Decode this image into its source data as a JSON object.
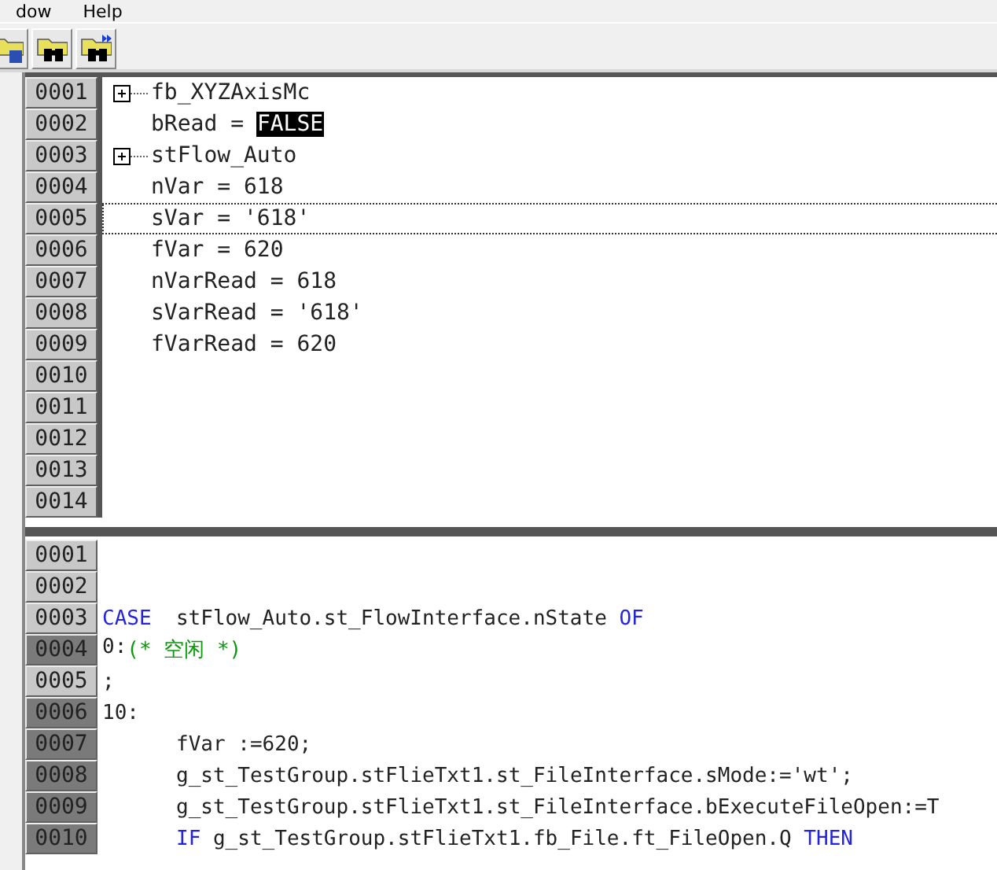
{
  "menu": [
    {
      "label": "dow"
    },
    {
      "label": "Help"
    }
  ],
  "toolbar": [
    {
      "kind": "save"
    },
    {
      "kind": "find"
    },
    {
      "kind": "find-next"
    }
  ],
  "watch": {
    "rows": [
      {
        "number": "0001",
        "expandable": true,
        "focused": false,
        "parts": [
          {
            "text": "fb_XYZAxisMc",
            "highlighted": false
          }
        ]
      },
      {
        "number": "0002",
        "expandable": false,
        "focused": false,
        "parts": [
          {
            "text": "bRead = ",
            "highlighted": false
          },
          {
            "text": "FALSE",
            "highlighted": true
          }
        ]
      },
      {
        "number": "0003",
        "expandable": true,
        "focused": false,
        "parts": [
          {
            "text": "stFlow_Auto",
            "highlighted": false
          }
        ]
      },
      {
        "number": "0004",
        "expandable": false,
        "focused": false,
        "parts": [
          {
            "text": "nVar = 618",
            "highlighted": false
          }
        ]
      },
      {
        "number": "0005",
        "expandable": false,
        "focused": true,
        "parts": [
          {
            "text": "sVar = '618'",
            "highlighted": false
          }
        ]
      },
      {
        "number": "0006",
        "expandable": false,
        "focused": false,
        "parts": [
          {
            "text": "fVar = 620",
            "highlighted": false
          }
        ]
      },
      {
        "number": "0007",
        "expandable": false,
        "focused": false,
        "parts": [
          {
            "text": "nVarRead = 618",
            "highlighted": false
          }
        ]
      },
      {
        "number": "0008",
        "expandable": false,
        "focused": false,
        "parts": [
          {
            "text": "sVarRead = '618'",
            "highlighted": false
          }
        ]
      },
      {
        "number": "0009",
        "expandable": false,
        "focused": false,
        "parts": [
          {
            "text": "fVarRead = 620",
            "highlighted": false
          }
        ]
      },
      {
        "number": "0010",
        "expandable": false,
        "focused": false
      },
      {
        "number": "0011",
        "expandable": false,
        "focused": false
      },
      {
        "number": "0012",
        "expandable": false,
        "focused": false
      },
      {
        "number": "0013",
        "expandable": false,
        "focused": false
      },
      {
        "number": "0014",
        "expandable": false,
        "focused": false
      }
    ]
  },
  "code": {
    "lines": [
      {
        "number": "0001",
        "executed": false
      },
      {
        "number": "0002",
        "executed": false
      },
      {
        "number": "0003",
        "executed": false,
        "indented": false,
        "tokens": [
          {
            "kind": "keyword",
            "text": "CASE"
          },
          {
            "kind": "plain",
            "text": "  stFlow_Auto.st_FlowInterface.nState "
          },
          {
            "kind": "keyword",
            "text": "OF"
          }
        ]
      },
      {
        "number": "0004",
        "executed": true,
        "indented": false,
        "tokens": [
          {
            "kind": "plain",
            "text": "0:"
          },
          {
            "kind": "comment",
            "text": "(* 空闲 *)"
          }
        ]
      },
      {
        "number": "0005",
        "executed": false,
        "indented": false,
        "tokens": [
          {
            "kind": "plain",
            "text": ";"
          }
        ]
      },
      {
        "number": "0006",
        "executed": true,
        "indented": false,
        "tokens": [
          {
            "kind": "plain",
            "text": "10:"
          }
        ]
      },
      {
        "number": "0007",
        "executed": true,
        "indented": true,
        "tokens": [
          {
            "kind": "plain",
            "text": "fVar :=620;"
          }
        ]
      },
      {
        "number": "0008",
        "executed": true,
        "indented": true,
        "tokens": [
          {
            "kind": "plain",
            "text": "g_st_TestGroup.stFlieTxt1.st_FileInterface.sMode:='wt';"
          }
        ]
      },
      {
        "number": "0009",
        "executed": true,
        "indented": true,
        "tokens": [
          {
            "kind": "plain",
            "text": "g_st_TestGroup.stFlieTxt1.st_FileInterface.bExecuteFileOpen:=T"
          }
        ]
      },
      {
        "number": "0010",
        "executed": true,
        "indented": true,
        "tokens": [
          {
            "kind": "keyword",
            "text": "IF"
          },
          {
            "kind": "plain",
            "text": " g_st_TestGroup.stFlieTxt1.fb_File.ft_FileOpen.Q "
          },
          {
            "kind": "keyword",
            "text": "THEN"
          }
        ]
      }
    ]
  }
}
